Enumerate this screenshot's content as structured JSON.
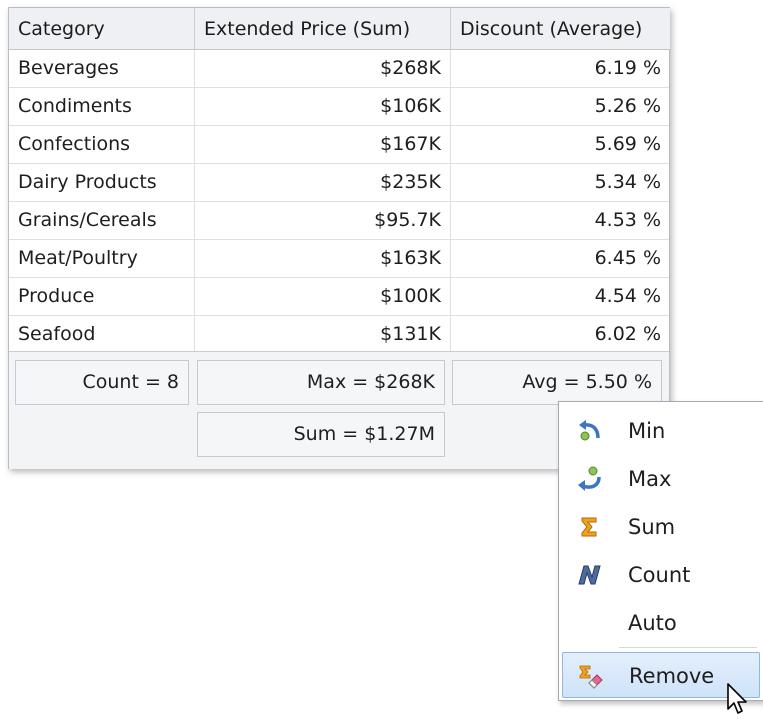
{
  "grid": {
    "headers": [
      "Category",
      "Extended Price (Sum)",
      "Discount (Average)"
    ],
    "rows": [
      {
        "category": "Beverages",
        "price": "$268K",
        "discount": "6.19 %"
      },
      {
        "category": "Condiments",
        "price": "$106K",
        "discount": "5.26 %"
      },
      {
        "category": "Confections",
        "price": "$167K",
        "discount": "5.69 %"
      },
      {
        "category": "Dairy Products",
        "price": "$235K",
        "discount": "5.34 %"
      },
      {
        "category": "Grains/Cereals",
        "price": "$95.7K",
        "discount": "4.53 %"
      },
      {
        "category": "Meat/Poultry",
        "price": "$163K",
        "discount": "6.45 %"
      },
      {
        "category": "Produce",
        "price": "$100K",
        "discount": "4.54 %"
      },
      {
        "category": "Seafood",
        "price": "$131K",
        "discount": "6.02 %"
      }
    ],
    "summary": {
      "count": "Count = 8",
      "max": "Max = $268K",
      "avg": "Avg = 5.50 %",
      "sum": "Sum = $1.27M"
    }
  },
  "context_menu": {
    "items": [
      {
        "label": "Min",
        "icon": "min-icon"
      },
      {
        "label": "Max",
        "icon": "max-icon"
      },
      {
        "label": "Sum",
        "icon": "sigma-icon"
      },
      {
        "label": "Count",
        "icon": "count-icon"
      },
      {
        "label": "Auto",
        "icon": ""
      },
      {
        "label": "Remove",
        "icon": "remove-icon",
        "highlighted": true
      }
    ]
  }
}
